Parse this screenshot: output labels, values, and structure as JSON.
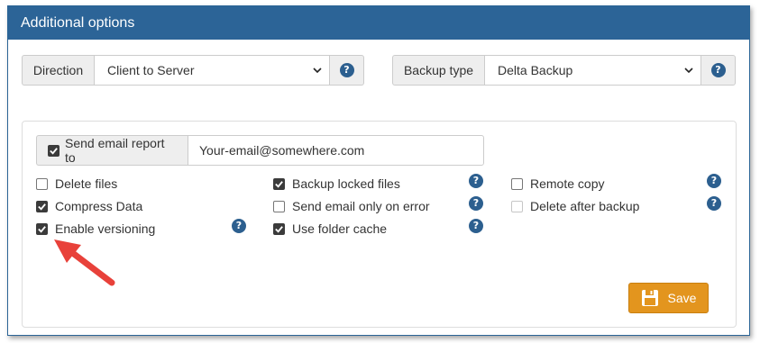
{
  "header": {
    "title": "Additional options"
  },
  "direction": {
    "label": "Direction",
    "value": "Client to Server",
    "help": "?"
  },
  "backup_type": {
    "label": "Backup type",
    "value": "Delta Backup",
    "help": "?"
  },
  "email": {
    "checkbox_label": "Send email report to",
    "checked": true,
    "value": "Your-email@somewhere.com"
  },
  "options": {
    "delete_files": {
      "label": "Delete files",
      "checked": false
    },
    "compress_data": {
      "label": "Compress Data",
      "checked": true
    },
    "enable_versioning": {
      "label": "Enable versioning",
      "checked": true
    },
    "backup_locked_files": {
      "label": "Backup locked files",
      "checked": true
    },
    "send_email_only_on_error": {
      "label": "Send email only on error",
      "checked": false
    },
    "use_folder_cache": {
      "label": "Use folder cache",
      "checked": true
    },
    "remote_copy": {
      "label": "Remote copy",
      "checked": false
    },
    "delete_after_backup": {
      "label": "Delete after backup",
      "checked": false,
      "disabled": true
    }
  },
  "help_glyph": "?",
  "save_button": {
    "label": "Save",
    "icon": "floppy-disk-icon"
  },
  "colors": {
    "header": "#2c6497",
    "save": "#e3951e",
    "help": "#2c5f8f",
    "arrow": "#e8413a"
  }
}
